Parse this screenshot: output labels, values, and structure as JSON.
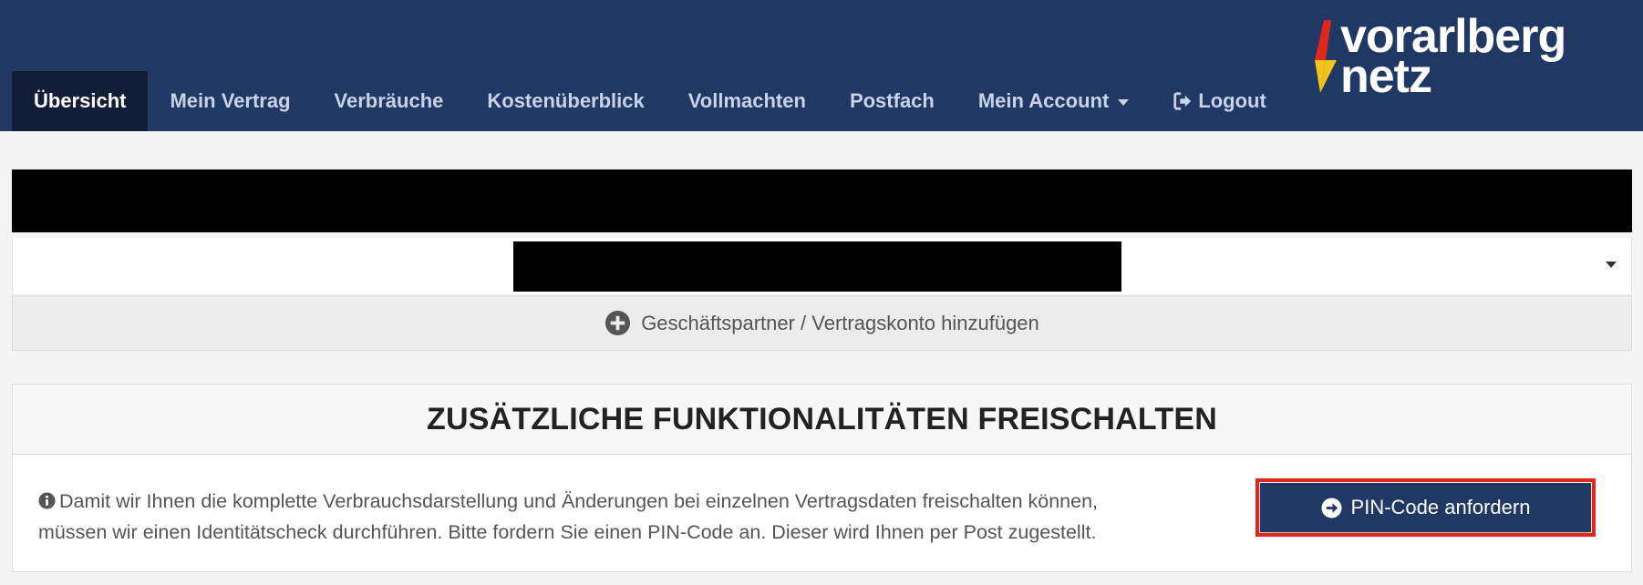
{
  "nav": {
    "items": [
      {
        "label": "Übersicht",
        "active": true
      },
      {
        "label": "Mein Vertrag"
      },
      {
        "label": "Verbräuche"
      },
      {
        "label": "Kostenüberblick"
      },
      {
        "label": "Vollmachten"
      },
      {
        "label": "Postfach"
      },
      {
        "label": "Mein Account",
        "dropdown": true
      },
      {
        "label": "Logout",
        "icon": "logout-icon"
      }
    ]
  },
  "logo": {
    "line1": "vorarlberg",
    "line2": "netz"
  },
  "contract_select": {
    "value": "[redacted]"
  },
  "add_account": {
    "label": "Geschäftspartner / Vertragskonto hinzufügen",
    "icon": "plus-circle-icon"
  },
  "unlock_panel": {
    "title": "ZUSÄTZLICHE FUNKTIONALITÄTEN FREISCHALTEN",
    "info_line1": "Damit wir Ihnen die komplette Verbrauchsdarstellung und Änderungen bei einzelnen Vertragsdaten freischalten können,",
    "info_line2": "müssen wir einen Identitätscheck durchführen. Bitte fordern Sie einen PIN-Code an. Dieser wird Ihnen per Post zugestellt.",
    "button_label": "PIN-Code anfordern"
  },
  "colors": {
    "primary": "#1f3864",
    "active_nav": "#121d3a",
    "highlight": "#e1261c"
  }
}
